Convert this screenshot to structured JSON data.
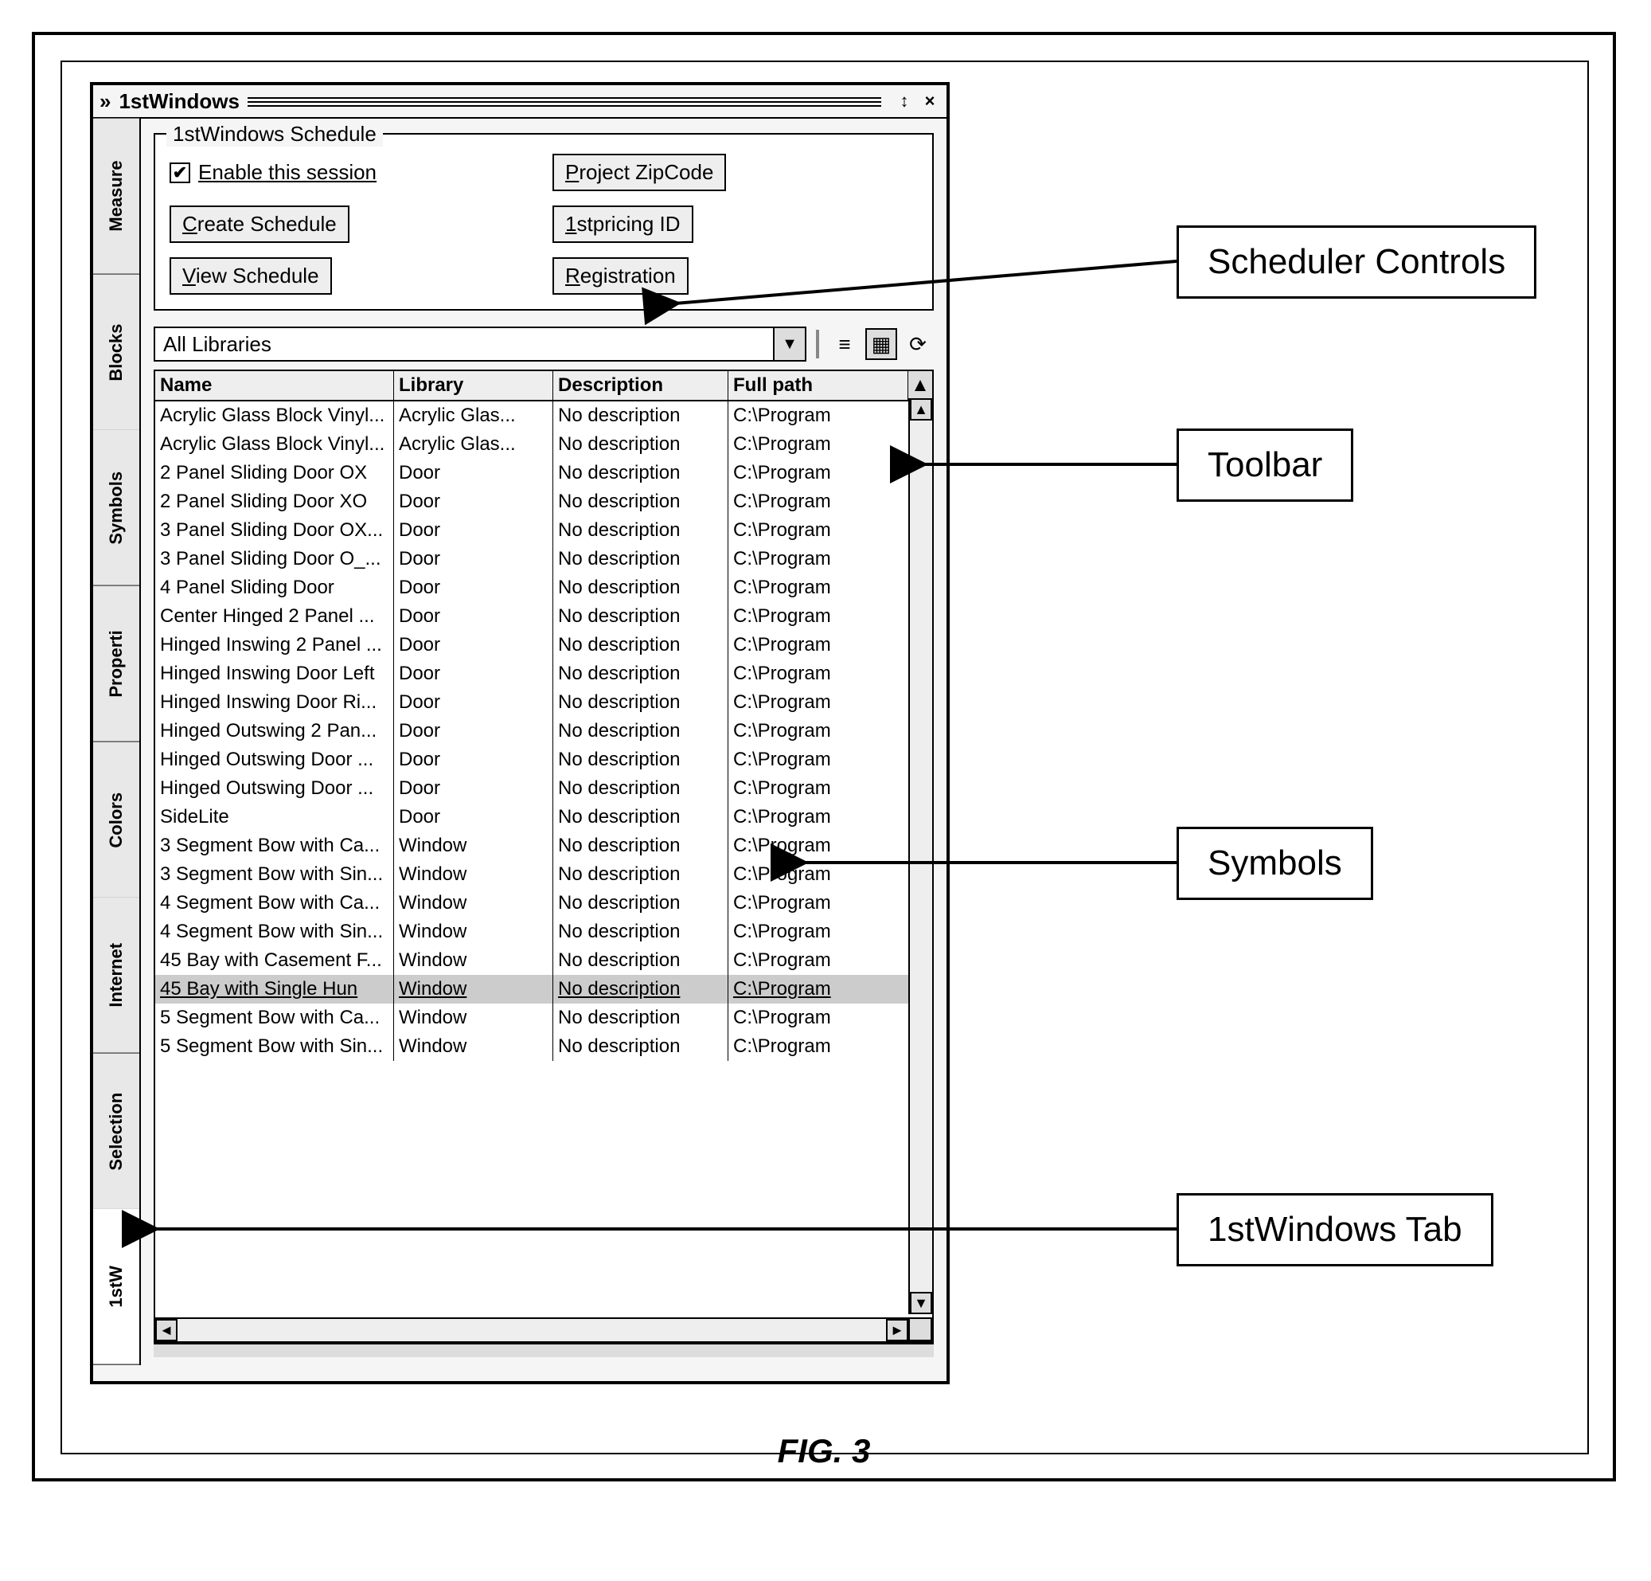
{
  "figure_label": "FIG. 3",
  "window": {
    "title": "1stWindows",
    "titlebar_buttons": {
      "resize": "↕",
      "close": "×"
    }
  },
  "side_tabs": [
    {
      "label": "Measure",
      "active": false
    },
    {
      "label": "Blocks",
      "active": false
    },
    {
      "label": "Symbols",
      "active": false
    },
    {
      "label": "Properti",
      "active": false
    },
    {
      "label": "Colors",
      "active": false
    },
    {
      "label": "Internet",
      "active": false
    },
    {
      "label": "Selection",
      "active": false
    },
    {
      "label": "1stW",
      "active": true
    }
  ],
  "schedule_group": {
    "title": "1stWindows Schedule",
    "enable_label": "Enable this session",
    "enable_checked": true,
    "buttons": {
      "project_zip": "Project ZipCode",
      "create_sched": "Create Schedule",
      "pricing_id": "1stpricing ID",
      "view_sched": "View Schedule",
      "registration": "Registration"
    }
  },
  "library_combo": {
    "value": "All Libraries"
  },
  "toolbar_icons": {
    "list_view": "≡",
    "thumb_view": "▦",
    "refresh": "⟳"
  },
  "table": {
    "columns": {
      "name": "Name",
      "library": "Library",
      "description": "Description",
      "path": "Full path"
    },
    "rows": [
      {
        "name": "Acrylic Glass Block Vinyl...",
        "library": "Acrylic Glas...",
        "description": "No description",
        "path": "C:\\Program"
      },
      {
        "name": "Acrylic Glass Block Vinyl...",
        "library": "Acrylic Glas...",
        "description": "No description",
        "path": "C:\\Program"
      },
      {
        "name": "2 Panel Sliding Door OX",
        "library": "Door",
        "description": "No description",
        "path": "C:\\Program"
      },
      {
        "name": "2 Panel Sliding Door XO",
        "library": "Door",
        "description": "No description",
        "path": "C:\\Program"
      },
      {
        "name": "3 Panel Sliding Door OX...",
        "library": "Door",
        "description": "No description",
        "path": "C:\\Program"
      },
      {
        "name": "3 Panel Sliding Door O_...",
        "library": "Door",
        "description": "No description",
        "path": "C:\\Program"
      },
      {
        "name": "4 Panel Sliding Door",
        "library": "Door",
        "description": "No description",
        "path": "C:\\Program"
      },
      {
        "name": "Center Hinged 2 Panel ...",
        "library": "Door",
        "description": "No description",
        "path": "C:\\Program"
      },
      {
        "name": "Hinged Inswing 2 Panel ...",
        "library": "Door",
        "description": "No description",
        "path": "C:\\Program"
      },
      {
        "name": "Hinged Inswing Door Left",
        "library": "Door",
        "description": "No description",
        "path": "C:\\Program"
      },
      {
        "name": "Hinged Inswing Door Ri...",
        "library": "Door",
        "description": "No description",
        "path": "C:\\Program"
      },
      {
        "name": "Hinged Outswing 2 Pan...",
        "library": "Door",
        "description": "No description",
        "path": "C:\\Program"
      },
      {
        "name": "Hinged Outswing Door ...",
        "library": "Door",
        "description": "No description",
        "path": "C:\\Program"
      },
      {
        "name": "Hinged Outswing Door ...",
        "library": "Door",
        "description": "No description",
        "path": "C:\\Program"
      },
      {
        "name": "SideLite",
        "library": "Door",
        "description": "No description",
        "path": "C:\\Program"
      },
      {
        "name": "3 Segment Bow with Ca...",
        "library": "Window",
        "description": "No description",
        "path": "C:\\Program"
      },
      {
        "name": "3 Segment Bow with Sin...",
        "library": "Window",
        "description": "No description",
        "path": "C:\\Program"
      },
      {
        "name": "4 Segment Bow with Ca...",
        "library": "Window",
        "description": "No description",
        "path": "C:\\Program"
      },
      {
        "name": "4 Segment Bow with Sin...",
        "library": "Window",
        "description": "No description",
        "path": "C:\\Program"
      },
      {
        "name": "45 Bay with Casement F...",
        "library": "Window",
        "description": "No description",
        "path": "C:\\Program"
      },
      {
        "name": "45 Bay with Single Hun",
        "library": "Window",
        "description": "No description",
        "path": "C:\\Program",
        "active": true
      },
      {
        "name": "5 Segment Bow with Ca...",
        "library": "Window",
        "description": "No description",
        "path": "C:\\Program"
      },
      {
        "name": "5 Segment Bow with Sin...",
        "library": "Window",
        "description": "No description",
        "path": "C:\\Program"
      }
    ]
  },
  "callouts": {
    "scheduler": "Scheduler Controls",
    "toolbar": "Toolbar",
    "symbols": "Symbols",
    "tab": "1stWindows Tab"
  }
}
